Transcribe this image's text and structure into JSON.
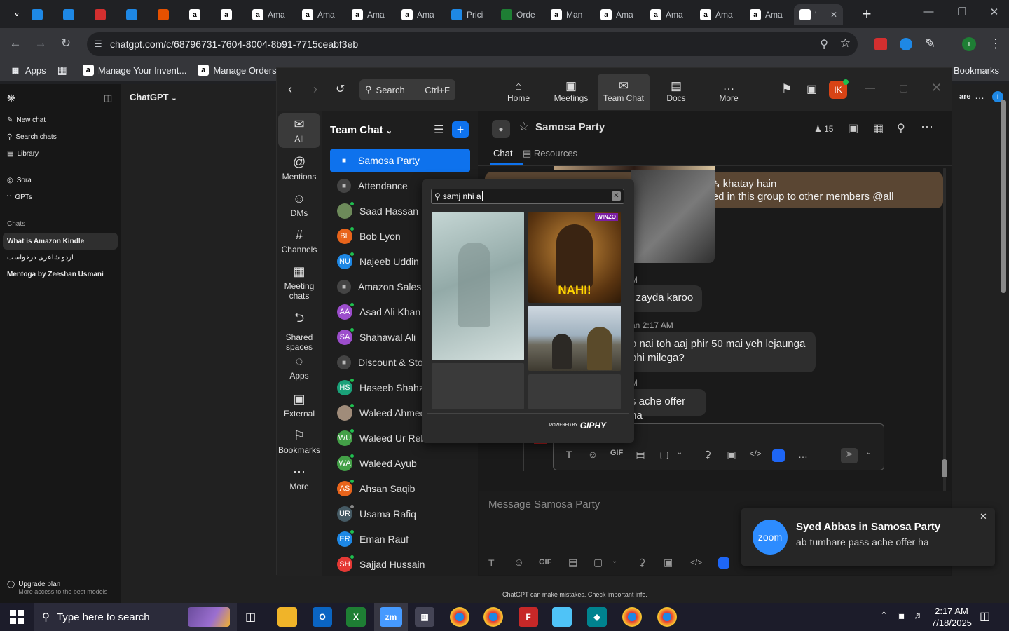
{
  "browser": {
    "tabs": [
      {
        "label": "",
        "icon": "dropdown-chevron-icon",
        "color": "#35363a"
      },
      {
        "label": "",
        "icon": "app-icon",
        "color": "#1e88e5"
      },
      {
        "label": "",
        "icon": "ec-icon",
        "color": "#1e88e5"
      },
      {
        "label": "",
        "icon": "pdf-icon",
        "color": "#d32f2f"
      },
      {
        "label": "",
        "icon": "doc-icon",
        "color": "#1e88e5"
      },
      {
        "label": "",
        "icon": "layers-icon",
        "color": "#e65100"
      },
      {
        "label": "",
        "icon": "amazon-icon",
        "color": "#ffffff"
      },
      {
        "label": "",
        "icon": "amazon-icon",
        "color": "#ffffff"
      },
      {
        "label": "Ama",
        "icon": "amazon-icon",
        "color": "#ffffff"
      },
      {
        "label": "Ama",
        "icon": "amazon-icon",
        "color": "#ffffff"
      },
      {
        "label": "Ama",
        "icon": "amazon-icon",
        "color": "#ffffff"
      },
      {
        "label": "Ama",
        "icon": "amazon-icon",
        "color": "#ffffff"
      },
      {
        "label": "Prici",
        "icon": "dollar-icon",
        "color": "#1e88e5"
      },
      {
        "label": "Orde",
        "icon": "excel-icon",
        "color": "#1e7e34"
      },
      {
        "label": "Man",
        "icon": "amazon-icon",
        "color": "#ffffff"
      },
      {
        "label": "Ama",
        "icon": "amazon-icon",
        "color": "#ffffff"
      },
      {
        "label": "Ama",
        "icon": "amazon-icon",
        "color": "#ffffff"
      },
      {
        "label": "Ama",
        "icon": "amazon-icon",
        "color": "#ffffff"
      },
      {
        "label": "Ama",
        "icon": "amazon-icon",
        "color": "#ffffff"
      },
      {
        "label": "'",
        "icon": "chatgpt-icon",
        "color": "#ffffff"
      }
    ],
    "new_tab": "+",
    "url": "chatgpt.com/c/68796731-7604-8004-8b91-7715ceabf3eb",
    "bookmarks": [
      {
        "label": "Apps",
        "icon": "apps-grid-icon"
      },
      {
        "label": "Manage Your Invent...",
        "icon": "amazon-icon"
      },
      {
        "label": "Manage Orders",
        "icon": "amazon-icon"
      }
    ],
    "all_bookmarks": "All Bookmarks"
  },
  "chatgpt": {
    "header": "ChatGPT",
    "nav": [
      {
        "label": "New chat",
        "icon": "new-chat-icon"
      },
      {
        "label": "Search chats",
        "icon": "search-icon"
      },
      {
        "label": "Library",
        "icon": "library-icon"
      }
    ],
    "nav2": [
      {
        "label": "Sora",
        "icon": "sora-icon"
      },
      {
        "label": "GPTs",
        "icon": "gpts-icon"
      }
    ],
    "chats_heading": "Chats",
    "chats": [
      "What is Amazon Kindle",
      "اردو شاعری درخواست",
      "Mentoga by Zeeshan Usmani"
    ],
    "upgrade_title": "Upgrade plan",
    "upgrade_sub": "More access to the best models",
    "disclaimer": "ChatGPT can make mistakes. Check important info.",
    "tools_label": "Tools",
    "share_label": "are"
  },
  "zoom": {
    "search_label": "Search",
    "search_shortcut": "Ctrl+F",
    "topnav": [
      {
        "label": "Home",
        "icon": "home-icon"
      },
      {
        "label": "Meetings",
        "icon": "video-camera-icon"
      },
      {
        "label": "Team Chat",
        "icon": "chat-bubbles-icon"
      },
      {
        "label": "Docs",
        "icon": "document-icon"
      },
      {
        "label": "More",
        "icon": "more-dots-icon"
      }
    ],
    "user_initials": "IK",
    "rail": [
      {
        "label": "All",
        "icon": "chat-icon"
      },
      {
        "label": "Mentions",
        "icon": "at-sign-icon"
      },
      {
        "label": "DMs",
        "icon": "people-icon"
      },
      {
        "label": "Channels",
        "icon": "hashtag-icon"
      },
      {
        "label": "Meeting chats",
        "icon": "calendar-chat-icon"
      },
      {
        "label": "Shared spaces",
        "icon": "share-nodes-icon"
      },
      {
        "label": "Apps",
        "icon": "apps-icon"
      },
      {
        "label": "External",
        "icon": "external-icon"
      },
      {
        "label": "Bookmarks",
        "icon": "bookmark-icon"
      },
      {
        "label": "More",
        "icon": "more-icon"
      }
    ],
    "list_title": "Team Chat",
    "channels": [
      {
        "label": "Samosa Party",
        "type": "lock",
        "color": "#0e72ed"
      },
      {
        "label": "Attendance",
        "type": "lock",
        "color": "#444444"
      },
      {
        "label": "Saad Hassan",
        "type": "photo",
        "color": "#6d8a5a"
      },
      {
        "label": "Bob Lyon",
        "type": "BL",
        "color": "#e8641b"
      },
      {
        "label": "Najeeb Uddin",
        "type": "NU",
        "color": "#1e88e5"
      },
      {
        "label": "Amazon Sales T",
        "type": "lock",
        "color": "#444444"
      },
      {
        "label": "Asad Ali Khan",
        "type": "AA",
        "color": "#9c4dcc"
      },
      {
        "label": "Shahawal Ali",
        "type": "SA",
        "color": "#9c4dcc"
      },
      {
        "label": "Discount & Stoc",
        "type": "lock",
        "color": "#444444"
      },
      {
        "label": "Haseeb Shahza",
        "type": "HS",
        "color": "#1aa179"
      },
      {
        "label": "Waleed Ahmed",
        "type": "photo",
        "color": "#a08c7a"
      },
      {
        "label": "Waleed Ur Rehr",
        "type": "WU",
        "color": "#43a047"
      },
      {
        "label": "Waleed Ayub",
        "type": "WA",
        "color": "#43a047"
      },
      {
        "label": "Ahsan Saqib",
        "type": "AS",
        "color": "#e8641b"
      },
      {
        "label": "Usama Rafiq",
        "type": "UR",
        "color": "#455a64"
      },
      {
        "label": "Eman Rauf",
        "type": "ER",
        "color": "#1e88e5"
      },
      {
        "label": "Sajjad Hussain",
        "type": "SH",
        "color": "#e53935"
      }
    ],
    "channel_title": "Samosa Party",
    "member_count": "15",
    "tabs": [
      {
        "label": "Chat"
      },
      {
        "label": "Resources"
      }
    ],
    "messages": {
      "pinned_line1": "her members jo 🛰 khatay hain",
      "pinned_line2": "ture and vdo shared in this group to other members @all",
      "m1": "i zayda karoo",
      "m1_meta": "M",
      "m2_meta": "an 2:17 AM",
      "m2_line1": "o nai toh aaj phir 50 mai yeh lejaunga",
      "m2_line2": " bhi milega?",
      "m3_meta": "M",
      "m3": "s ache offer ha"
    },
    "gif_search_value": "samj nhi a",
    "gif_powered": "POWERED BY",
    "gif_brand": "GIPHY",
    "gif_label_nahi": "NAHI!",
    "gif_label_winzo": "WINZO",
    "composer_placeholder": "Message Samosa Party",
    "gif_button": "GIF"
  },
  "toast": {
    "brand": "zoom",
    "title": "Syed Abbas in Samosa Party",
    "body": "ab tumhare pass ache offer ha"
  },
  "taskbar": {
    "search_placeholder": "Type here to search",
    "time": "2:17 AM",
    "date": "7/18/2025"
  }
}
